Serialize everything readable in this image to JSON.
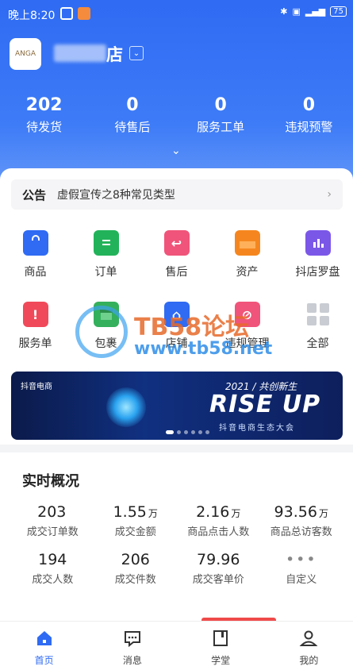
{
  "status_bar": {
    "time": "晚上8:20",
    "battery": "75"
  },
  "shop": {
    "name_suffix": "店",
    "logo_text": "ANGA"
  },
  "stats": [
    {
      "value": "202",
      "label": "待发货"
    },
    {
      "value": "0",
      "label": "待售后"
    },
    {
      "value": "0",
      "label": "服务工单"
    },
    {
      "value": "0",
      "label": "违规预警"
    }
  ],
  "notice": {
    "tag": "公告",
    "text": "虚假宣传之8种常见类型"
  },
  "grid": {
    "row1": [
      {
        "label": "商品",
        "color": "#2f6bf3"
      },
      {
        "label": "订单",
        "color": "#22b35a"
      },
      {
        "label": "售后",
        "color": "#f0547a"
      },
      {
        "label": "资产",
        "color": "#f5861f"
      },
      {
        "label": "抖店罗盘",
        "color": "#7b57e8"
      }
    ],
    "row2": [
      {
        "label": "服务单",
        "color": "#f04a5a"
      },
      {
        "label": "包裹",
        "color": "#34b05c"
      },
      {
        "label": "店铺",
        "color": "#2f6bf3"
      },
      {
        "label": "违规管理",
        "color": "#f0547a"
      },
      {
        "label": "全部",
        "color": "#c9ccd2"
      }
    ]
  },
  "watermark": {
    "line1": "TB58论坛",
    "line2": "www.tb58.net"
  },
  "banner": {
    "brand": "抖音电商",
    "year_text": "2021 / 共创新生",
    "headline": "RISE UP",
    "subtitle": "抖音电商生态大会"
  },
  "realtime": {
    "title": "实时概况",
    "row1": [
      {
        "value": "203",
        "unit": "",
        "label": "成交订单数"
      },
      {
        "value": "1.55",
        "unit": "万",
        "label": "成交金额"
      },
      {
        "value": "2.16",
        "unit": "万",
        "label": "商品点击人数"
      },
      {
        "value": "93.56",
        "unit": "万",
        "label": "商品总访客数"
      }
    ],
    "row2": [
      {
        "value": "194",
        "unit": "",
        "label": "成交人数"
      },
      {
        "value": "206",
        "unit": "",
        "label": "成交件数"
      },
      {
        "value": "79.96",
        "unit": "",
        "label": "成交客单价"
      },
      {
        "value": "•••",
        "unit": "",
        "label": "自定义"
      }
    ]
  },
  "tabbar": [
    {
      "label": "首页",
      "icon": "home-icon",
      "active": true
    },
    {
      "label": "消息",
      "icon": "message-icon",
      "active": false
    },
    {
      "label": "学堂",
      "icon": "book-icon",
      "active": false
    },
    {
      "label": "我的",
      "icon": "user-icon",
      "active": false
    }
  ]
}
